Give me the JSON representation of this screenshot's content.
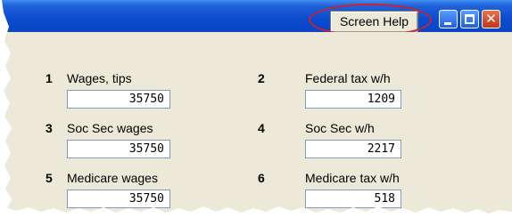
{
  "title_bar": {
    "help_button_label": "Screen Help",
    "close_glyph": "✕"
  },
  "boxes": [
    {
      "number": "1",
      "label": "Wages, tips",
      "value": "35750"
    },
    {
      "number": "2",
      "label": "Federal tax w/h",
      "value": "1209"
    },
    {
      "number": "3",
      "label": "Soc Sec wages",
      "value": "35750"
    },
    {
      "number": "4",
      "label": "Soc Sec w/h",
      "value": "2217"
    },
    {
      "number": "5",
      "label": "Medicare wages",
      "value": "35750"
    },
    {
      "number": "6",
      "label": "Medicare tax w/h",
      "value": "518"
    }
  ],
  "colors": {
    "titlebar": "#0a4bd0",
    "panel": "#ece9d8",
    "highlight_oval": "#d0202a",
    "field_border": "#7f9db9"
  }
}
